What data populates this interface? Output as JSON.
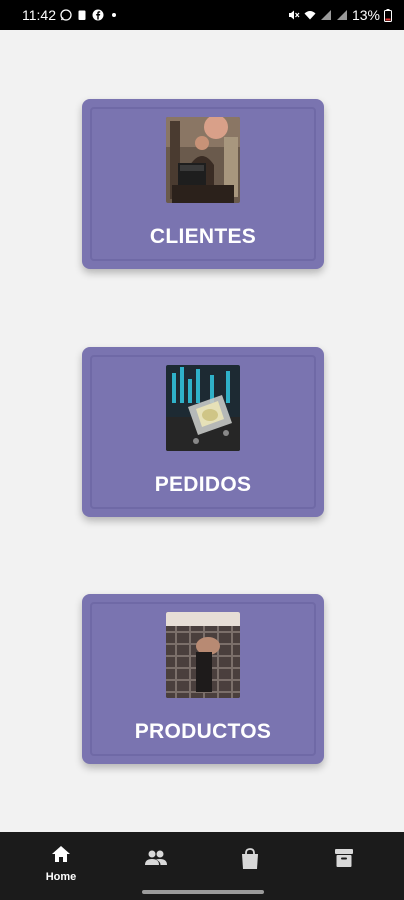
{
  "status_bar": {
    "time": "11:42",
    "battery": "13%"
  },
  "cards": [
    {
      "label": "CLIENTES",
      "image": "shopkeeper-photo"
    },
    {
      "label": "PEDIDOS",
      "image": "shopping-cart-photo"
    },
    {
      "label": "PRODUCTOS",
      "image": "clothing-photo"
    }
  ],
  "bottom_nav": {
    "items": [
      {
        "label": "Home",
        "icon": "home-icon",
        "active": true
      },
      {
        "label": "",
        "icon": "people-icon"
      },
      {
        "label": "",
        "icon": "shopping-bag-icon"
      },
      {
        "label": "",
        "icon": "archive-icon"
      }
    ]
  },
  "colors": {
    "card": "#7a74b0",
    "background": "#f2f2f2",
    "nav": "#1b1b1b"
  }
}
